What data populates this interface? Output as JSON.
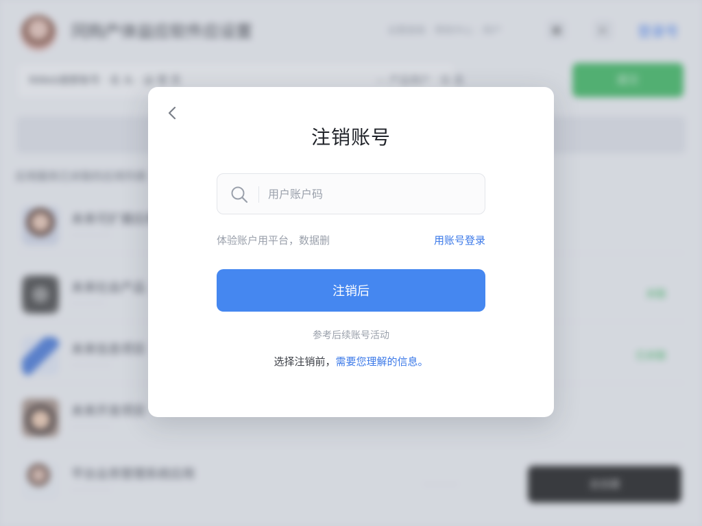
{
  "background": {
    "header_title": "冈购产体益应软件应设置",
    "top_links": "设置面板  ·  帮助中心  ·  用户",
    "top_btn_1": "▣",
    "top_btn_2": "▸",
    "top_link": "登录号",
    "search_text": "NWeb搜索账号 · 名 头 · 运 营 员",
    "search_text_right": "— 产品用户 · 信 息",
    "green_button": "提交",
    "section_label": "应用服务已关联的应用列表",
    "rows": [
      {
        "title": "未来可扩展应用",
        "sub": "· · · · · · ·",
        "tag": ""
      },
      {
        "title": "未来社会产品",
        "sub": "· · · · · ·",
        "tag": "关联"
      },
      {
        "title": "未来信息项目",
        "sub": "· · · · · · ·",
        "tag": "已关联"
      },
      {
        "title": "未来开发项目",
        "sub": "· · · · · · ·",
        "tag": ""
      },
      {
        "title": "平台业务管理系统应用",
        "sub": "· · · · · · ·",
        "tag": ""
      }
    ],
    "mid_text": "· · · · · ·",
    "black_button": "去创建"
  },
  "modal": {
    "title": "注销账号",
    "input_placeholder": "用户账户码",
    "hint_left": "体验账户用平台，数据删",
    "hint_link": "用账号登录",
    "primary_button": "注销后",
    "sub_note": "参考后续账号活动",
    "bottom_text": "选择注销前，",
    "bottom_link": "需要您理解的信息。"
  },
  "colors": {
    "accent": "#4587f0",
    "link": "#3a78e8",
    "green": "#2fb455"
  }
}
